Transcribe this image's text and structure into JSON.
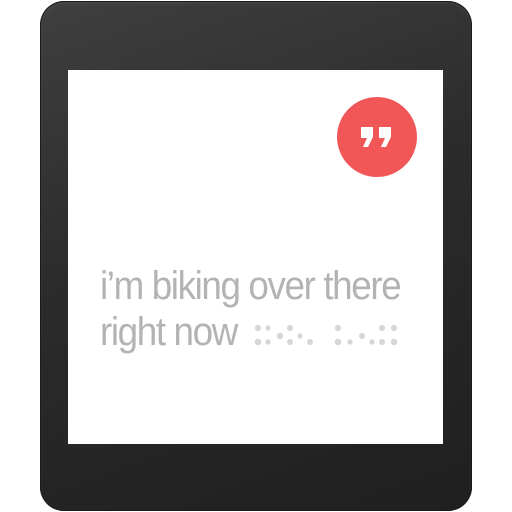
{
  "screen": {
    "reply_button": {
      "icon": "quote-icon",
      "color": "#f25757"
    },
    "transcript": {
      "line1": "i’m biking over there",
      "line2": "right now",
      "color": "#b3b3b3"
    },
    "listening_indicator": {
      "icon": "voice-dots-icon",
      "color": "#d6d6d6"
    }
  }
}
